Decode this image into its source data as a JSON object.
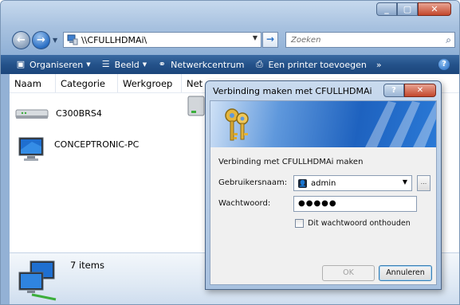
{
  "explorer": {
    "address": "\\\\CFULLHDMAi\\",
    "search_placeholder": "Zoeken",
    "toolbar": {
      "organize": "Organiseren",
      "view": "Beeld",
      "network_center": "Netwerkcentrum",
      "add_printer": "Een printer toevoegen",
      "more": "»",
      "help": "?"
    },
    "columns": [
      "Naam",
      "Categorie",
      "Werkgroep",
      "Net"
    ],
    "items": [
      {
        "label": "C300BRS4",
        "icon": "router-device-icon"
      },
      {
        "label": "CONCEPTRONIC-PC",
        "icon": "computer-monitor-icon"
      }
    ],
    "details": {
      "count": "7 items"
    }
  },
  "dialog": {
    "title": "Verbinding maken met CFULLHDMAi",
    "subtitle": "Verbinding met CFULLHDMAi maken",
    "username_label": "Gebruikersnaam:",
    "username_value": "admin",
    "password_label": "Wachtwoord:",
    "password_value": "●●●●●",
    "remember_label": "Dit wachtwoord onthouden",
    "remember_checked": false,
    "ok_label": "OK",
    "cancel_label": "Annuleren",
    "help_glyph": "?",
    "browse_glyph": "..."
  },
  "colors": {
    "toolbar_blue": "#24528a",
    "banner_blue": "#1e62bf",
    "accent_orange": "#e08a20"
  }
}
